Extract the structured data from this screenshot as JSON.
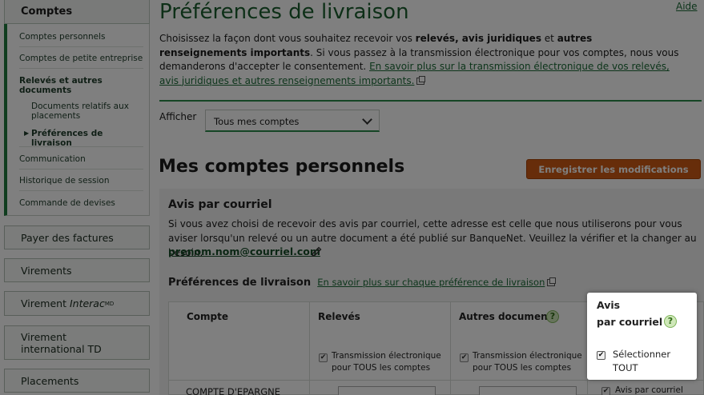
{
  "sidebar": {
    "header": "Comptes",
    "items": [
      {
        "label": "Comptes personnels"
      },
      {
        "label": "Comptes de petite entreprise"
      },
      {
        "label": "Relevés et autres documents"
      },
      {
        "label": "Documents relatifs aux placements"
      },
      {
        "label": "Préférences de livraison"
      },
      {
        "label": "Communication"
      },
      {
        "label": "Historique de session"
      },
      {
        "label": "Commande de devises"
      }
    ],
    "menus": [
      {
        "label": "Payer des factures"
      },
      {
        "label": "Virements"
      },
      {
        "label_prefix": "Virement ",
        "label_italic": "Interac",
        "label_sup": "MD"
      },
      {
        "label": "Virement international TD"
      },
      {
        "label": "Placements"
      }
    ]
  },
  "header": {
    "title": "Préférences de livraison",
    "help": "Aide"
  },
  "intro": {
    "p1": "Choisissez la façon dont vous souhaitez recevoir vos ",
    "b1": "relevés, avis juridiques",
    "p2": " et ",
    "b2": "autres renseignements importants",
    "p3": ". Si vous passez à la transmission électronique pour vos comptes, nous vous demanderons d'accepter le consentement. ",
    "link": "En savoir plus sur la transmission électronique de vos relevés, avis juridiques et autres renseignements importants."
  },
  "filter": {
    "label": "Afficher",
    "selected": "Tous mes comptes"
  },
  "section": {
    "title": "Mes comptes personnels",
    "save_button": "Enregistrer les modifications"
  },
  "email_notice": {
    "title": "Avis par courriel",
    "description": "Si vous avez choisi de recevoir des avis par courriel, cette adresse est celle que nous utiliserons pour vous aviser lorsqu'un relevé ou un autre document a été publié sur BanqueNet. Veuillez la vérifier et la changer au besoin.",
    "email": "prenom.nom@courriel.com"
  },
  "delivery": {
    "heading": "Préférences de livraison",
    "link": "En savoir plus sur chaque préférence de livraison"
  },
  "table": {
    "columns": {
      "account": "Compte",
      "statements": "Relevés",
      "other_docs": "Autres documents",
      "email_notice_l1": "Avis",
      "email_notice_l2": "par courriel"
    },
    "bulk_electronic": "Transmission électronique pour TOUS les comptes",
    "select_all": "Sélectionner TOUT",
    "rows": [
      {
        "account": "COMPTE D'EPARGNE",
        "email_notice": "Avis par courriel"
      }
    ]
  }
}
